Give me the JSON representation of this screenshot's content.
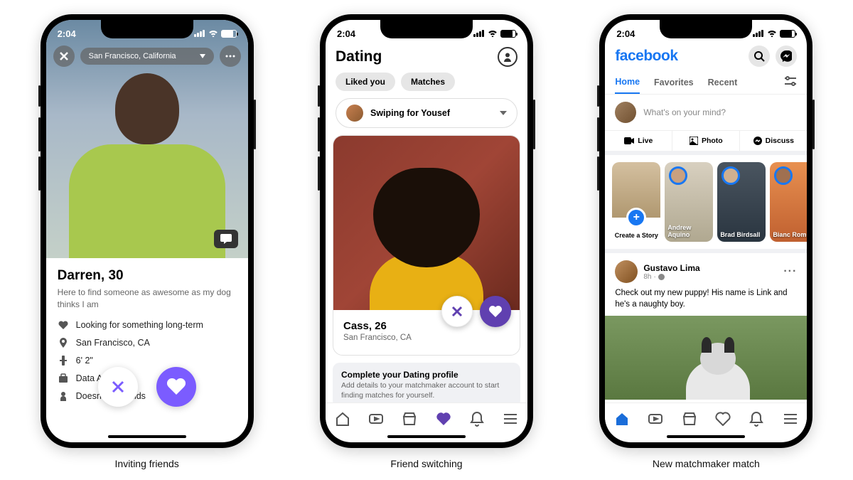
{
  "status": {
    "time": "2:04"
  },
  "captions": [
    "Inviting friends",
    "Friend switching",
    "New matchmaker match"
  ],
  "phone1": {
    "location": "San Francisco, California",
    "name": "Darren, 30",
    "bio": "Here to find someone as awesome as my dog thinks I am",
    "details": [
      {
        "icon": "heart-icon",
        "text": "Looking for something long-term"
      },
      {
        "icon": "pin-icon",
        "text": "San Francisco, CA"
      },
      {
        "icon": "height-icon",
        "text": "6' 2\""
      },
      {
        "icon": "briefcase-icon",
        "text": "Data A"
      },
      {
        "icon": "baby-icon",
        "text": "Doesn't have kids"
      }
    ]
  },
  "phone2": {
    "title": "Dating",
    "tabs": [
      "Liked you",
      "Matches"
    ],
    "swiping_for": "Swiping for Yousef",
    "name": "Cass, 26",
    "location": "San Francisco, CA",
    "banner_title": "Complete your Dating profile",
    "banner_text": "Add details to your matchmaker account to start finding matches for yourself."
  },
  "phone3": {
    "logo": "facebook",
    "tabs": [
      "Home",
      "Favorites",
      "Recent"
    ],
    "composer_placeholder": "What's on your mind?",
    "composer_actions": [
      "Live",
      "Photo",
      "Discuss"
    ],
    "stories": [
      {
        "label": "Create a Story",
        "create": true
      },
      {
        "label": "Andrew Aquino"
      },
      {
        "label": "Brad Birdsall"
      },
      {
        "label": "Bianc Romu"
      }
    ],
    "post": {
      "author": "Gustavo Lima",
      "time": "8h",
      "text": "Check out my new puppy! His name is Link and he's a naughty boy."
    }
  }
}
